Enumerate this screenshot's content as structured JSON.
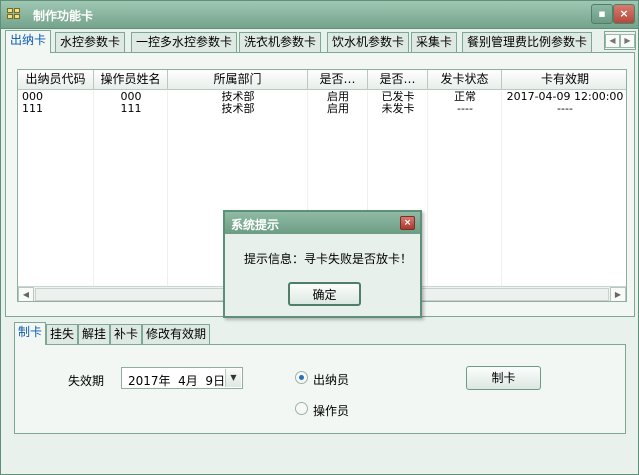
{
  "window": {
    "title": "制作功能卡",
    "minimize_glyph": "▪",
    "close_glyph": "×"
  },
  "tabs": [
    "出纳卡",
    "水控参数卡",
    "一控多水控参数卡",
    "洗衣机参数卡",
    "饮水机参数卡",
    "采集卡",
    "餐别管理费比例参数卡"
  ],
  "tab_scroll": {
    "prev": "◀",
    "next": "▶"
  },
  "grid": {
    "columns": [
      "出纳员代码",
      "操作员姓名",
      "所属部门",
      "是否…",
      "是否…",
      "发卡状态",
      "卡有效期"
    ],
    "rows": [
      [
        "000",
        "000",
        "技术部",
        "启用",
        "已发卡",
        "正常",
        "2017-04-09 12:00:00"
      ],
      [
        "111",
        "111",
        "技术部",
        "启用",
        "未发卡",
        "----",
        "----"
      ]
    ],
    "scroll_left": "◀",
    "scroll_right": "▶"
  },
  "lower_tabs": [
    "制卡",
    "挂失",
    "解挂",
    "补卡",
    "修改有效期"
  ],
  "form": {
    "expire_label": "失效期",
    "expire_value": "2017年  4月  9日",
    "dropdown_glyph": "▼",
    "radio_cashier": "出纳员",
    "radio_operator": "操作员",
    "selected_role": "出纳员",
    "make_card_button": "制卡"
  },
  "dialog": {
    "title": "系统提示",
    "close_glyph": "×",
    "message": "提示信息：寻卡失败是否放卡！",
    "ok_button": "确定"
  }
}
